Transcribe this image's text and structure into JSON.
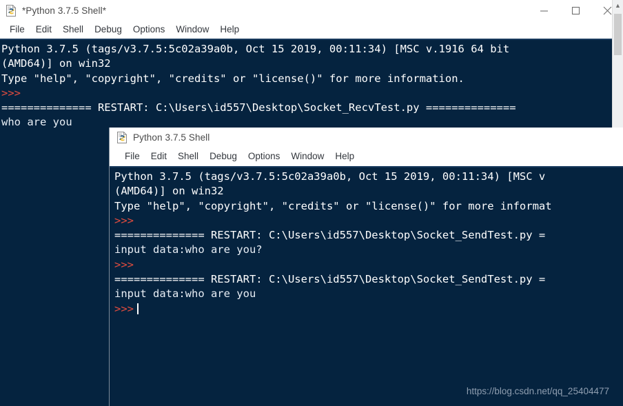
{
  "window1": {
    "title": "*Python 3.7.5 Shell*",
    "icon": "python-file-icon",
    "controls": {
      "minimize": "minimize-icon",
      "maximize": "maximize-icon",
      "close": "close-icon"
    },
    "menu": [
      "File",
      "Edit",
      "Shell",
      "Debug",
      "Options",
      "Window",
      "Help"
    ],
    "console_lines": [
      {
        "type": "out",
        "text": "Python 3.7.5 (tags/v3.7.5:5c02a39a0b, Oct 15 2019, 00:11:34) [MSC v.1916 64 bit"
      },
      {
        "type": "out",
        "text": "(AMD64)] on win32"
      },
      {
        "type": "out",
        "text": "Type \"help\", \"copyright\", \"credits\" or \"license()\" for more information."
      },
      {
        "type": "prompt",
        "text": ">>>"
      },
      {
        "type": "restart",
        "text": "============== RESTART: C:\\Users\\id557\\Desktop\\Socket_RecvTest.py =============="
      },
      {
        "type": "userin",
        "text": "who are you"
      }
    ]
  },
  "window2": {
    "title": "Python 3.7.5 Shell",
    "icon": "python-file-icon",
    "menu": [
      "File",
      "Edit",
      "Shell",
      "Debug",
      "Options",
      "Window",
      "Help"
    ],
    "console_lines": [
      {
        "type": "out",
        "text": "Python 3.7.5 (tags/v3.7.5:5c02a39a0b, Oct 15 2019, 00:11:34) [MSC v"
      },
      {
        "type": "out",
        "text": "(AMD64)] on win32"
      },
      {
        "type": "out",
        "text": "Type \"help\", \"copyright\", \"credits\" or \"license()\" for more informat"
      },
      {
        "type": "prompt",
        "text": ">>>"
      },
      {
        "type": "restart",
        "text": "============== RESTART: C:\\Users\\id557\\Desktop\\Socket_SendTest.py ="
      },
      {
        "type": "userin",
        "text": "input data:who are you?"
      },
      {
        "type": "prompt",
        "text": ">>>"
      },
      {
        "type": "restart",
        "text": "============== RESTART: C:\\Users\\id557\\Desktop\\Socket_SendTest.py ="
      },
      {
        "type": "userin",
        "text": "input data:who are you"
      },
      {
        "type": "prompt-caret",
        "text": ">>>"
      }
    ]
  },
  "watermark": "https://blog.csdn.net/qq_25404477",
  "colors": {
    "console_bg": "#05233f",
    "console_text": "#ffffff",
    "prompt": "#e24c3f",
    "chrome_bg": "#ffffff",
    "menu_text": "#33373d",
    "watermark_text": "#8f9eb0"
  }
}
